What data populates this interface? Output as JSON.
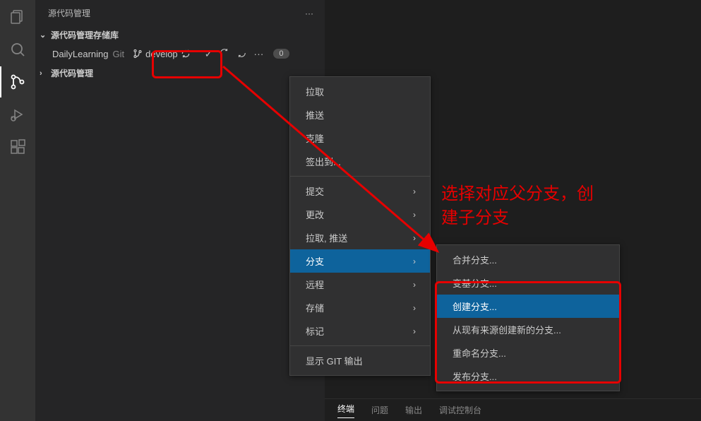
{
  "sidebar": {
    "title": "源代码管理",
    "section_repos": "源代码管理存储库",
    "section_scm": "源代码管理",
    "repo": {
      "name": "DailyLearning",
      "type": "Git",
      "branch": "develop",
      "badge": "0"
    }
  },
  "menu1": {
    "pull": "拉取",
    "push": "推送",
    "clone": "克隆",
    "checkout": "签出到...",
    "commit": "提交",
    "changes": "更改",
    "pull_push": "拉取, 推送",
    "branch": "分支",
    "remote": "远程",
    "stash": "存储",
    "tags": "标记",
    "show_git_output": "显示 GIT 输出"
  },
  "menu2": {
    "merge_branch": "合并分支...",
    "rebase_branch": "变基分支...",
    "create_branch": "创建分支...",
    "create_branch_from": "从现有来源创建新的分支...",
    "rename_branch": "重命名分支...",
    "publish_branch": "发布分支..."
  },
  "annotation": {
    "text": "选择对应父分支，创\n建子分支"
  },
  "terminal": {
    "tab1": "终端",
    "tab2": "问题",
    "tab3": "输出",
    "tab4": "调试控制台"
  }
}
